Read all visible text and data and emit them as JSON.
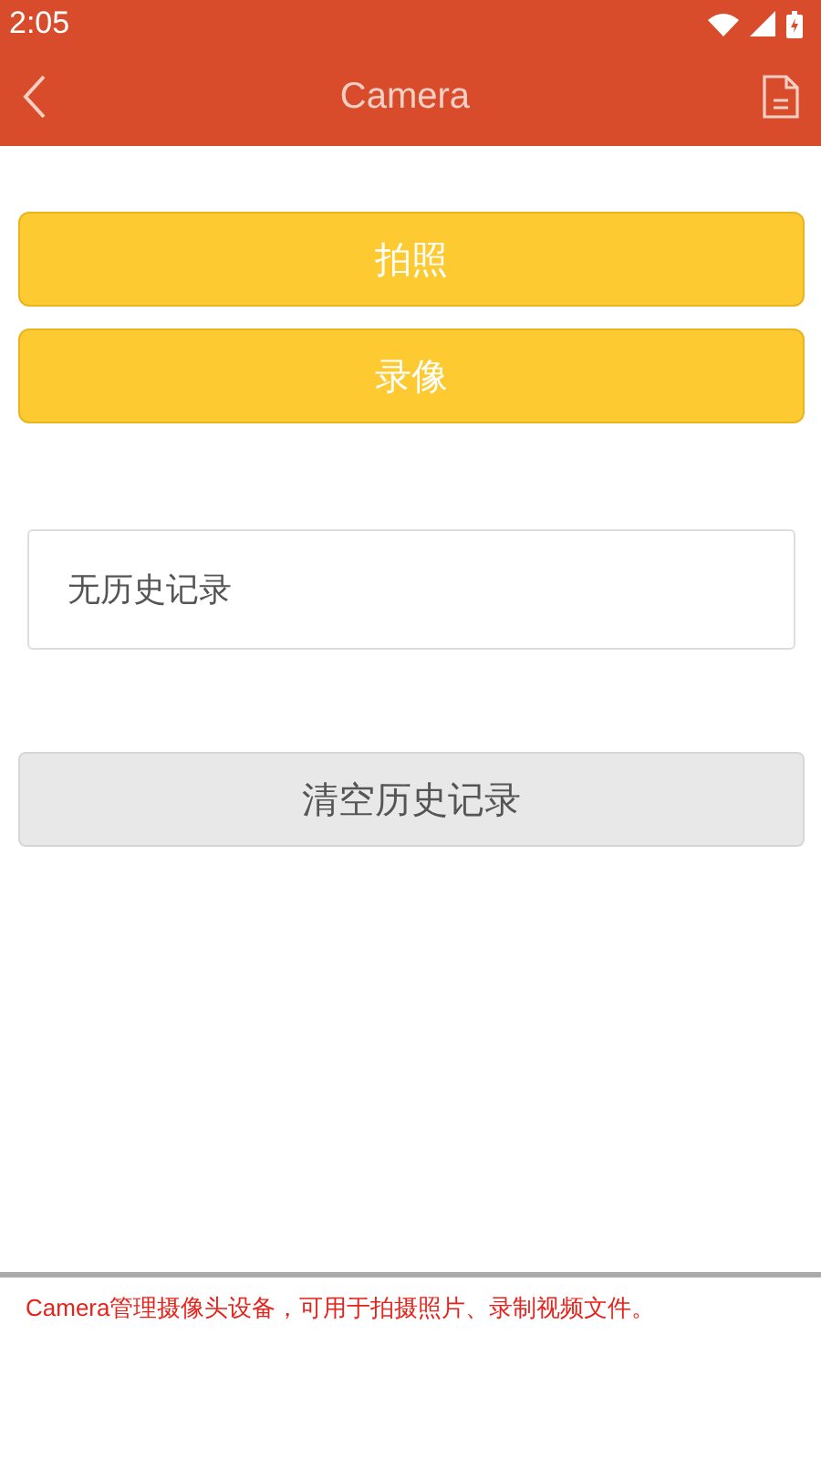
{
  "status_bar": {
    "time": "2:05"
  },
  "toolbar": {
    "title": "Camera"
  },
  "buttons": [
    {
      "label": "拍照"
    },
    {
      "label": "录像"
    }
  ],
  "history": {
    "text": "无历史记录"
  },
  "clear_button": {
    "label": "清空历史记录"
  },
  "footer": {
    "text": "Camera管理摄像头设备，可用于拍摄照片、录制视频文件。"
  }
}
